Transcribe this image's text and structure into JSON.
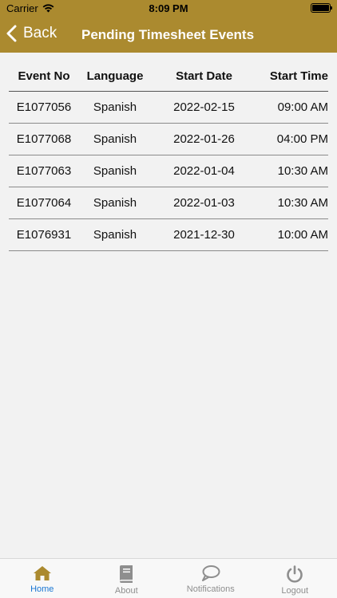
{
  "status_bar": {
    "carrier": "Carrier",
    "time": "8:09 PM"
  },
  "nav": {
    "back_label": "Back",
    "title": "Pending Timesheet Events"
  },
  "table": {
    "headers": [
      "Event No",
      "Language",
      "Start Date",
      "Start Time"
    ],
    "rows": [
      [
        "E1077056",
        "Spanish",
        "2022-02-15",
        "09:00 AM"
      ],
      [
        "E1077068",
        "Spanish",
        "2022-01-26",
        "04:00 PM"
      ],
      [
        "E1077063",
        "Spanish",
        "2022-01-04",
        "10:30 AM"
      ],
      [
        "E1077064",
        "Spanish",
        "2022-01-03",
        "10:30 AM"
      ],
      [
        "E1076931",
        "Spanish",
        "2021-12-30",
        "10:00 AM"
      ]
    ]
  },
  "tabbar": {
    "items": [
      {
        "label": "Home",
        "icon": "home-icon",
        "active": true
      },
      {
        "label": "About",
        "icon": "book-icon",
        "active": false
      },
      {
        "label": "Notifications",
        "icon": "chat-bubble-icon",
        "active": false
      },
      {
        "label": "Logout",
        "icon": "power-icon",
        "active": false
      }
    ]
  },
  "colors": {
    "header": "#ab8a2f",
    "active_tab": "#1976d2",
    "inactive_tab": "#8e8e8e"
  }
}
